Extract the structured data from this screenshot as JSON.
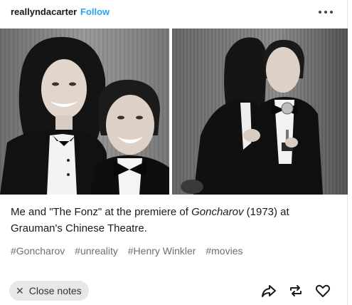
{
  "post": {
    "username": "reallyndacarter",
    "follow_label": "Follow",
    "more_icon": "more-horizontal-icon"
  },
  "caption": {
    "part1": "Me and \"The Fonz\" at the premiere of ",
    "film": "Goncharov",
    "part2": " (1973) at Grauman's Chinese Theatre."
  },
  "tags": [
    "#Goncharov",
    "#unreality",
    "#Henry Winkler",
    "#movies"
  ],
  "footer": {
    "close_notes_label": "Close notes",
    "icons": [
      "share-icon",
      "reblog-icon",
      "like-icon"
    ]
  },
  "colors": {
    "follow": "#2aa4ec",
    "tag_text": "#6f6f6f",
    "pill_bg": "#e7e7e7"
  }
}
